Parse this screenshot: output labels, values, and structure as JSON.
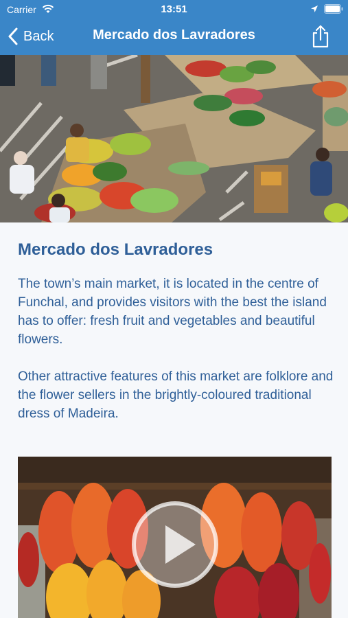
{
  "status_bar": {
    "carrier": "Carrier",
    "time": "13:51"
  },
  "nav": {
    "back_label": "Back",
    "title": "Mercado dos Lavradores"
  },
  "content": {
    "heading": "Mercado dos Lavradores",
    "paragraphs": [
      "The town’s main market, it is located in the centre of Funchal, and provides visitors with the best the island has to offer: fresh fruit and vegetables and beautiful flowers.",
      "Other attractive features of this market are folklore and the flower sellers in the brightly-coloured traditional dress of Madeira."
    ]
  },
  "colors": {
    "nav_background": "#3a86c8",
    "heading": "#2f5f98",
    "page_background": "#f6f8fb"
  },
  "icons": [
    "wifi-icon",
    "location-icon",
    "battery-icon",
    "chevron-left-icon",
    "share-icon",
    "play-icon"
  ]
}
